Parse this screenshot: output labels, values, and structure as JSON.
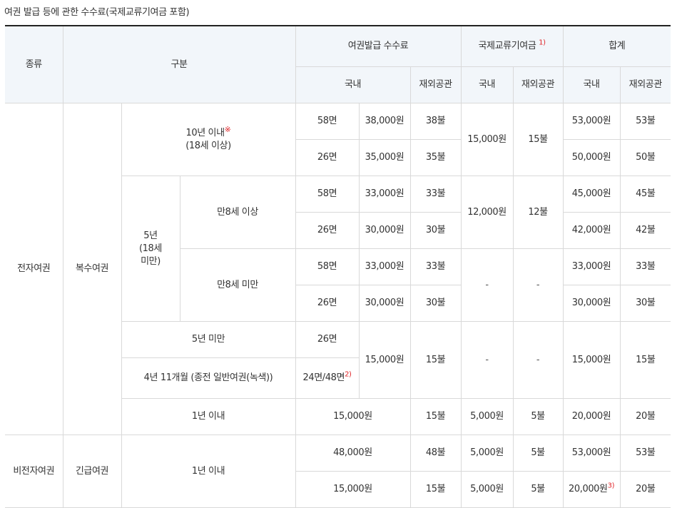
{
  "caption": "여권 발급 등에 관한 수수료(국제교류기여금 포함)",
  "header": {
    "type": "종류",
    "category": "구분",
    "passport_fee": "여권발급 수수료",
    "contribution": "국제교류기여금",
    "contribution_note": "1)",
    "total": "합계",
    "domestic": "국내",
    "overseas": "재외공관"
  },
  "labels": {
    "e_passport": "전자여권",
    "non_e_passport": "비전자여권",
    "multiple": "복수여권",
    "emergency": "긴급여권",
    "ten_years": "10년 이내",
    "ten_mark": "※",
    "ten_age": "(18세 이상)",
    "five_years_a": "5년",
    "five_years_b": "(18세",
    "five_years_c": "미만)",
    "age8_over": "만8세 이상",
    "age8_under": "만8세 미만",
    "under5": "5년 미만",
    "four_years": "4년 11개월 (종전 일반여권(녹색))",
    "one_year": "1년 이내",
    "one_year_b": "1년 이내"
  },
  "rows": [
    {
      "pages": "58면",
      "dom": "38,000원",
      "ovs": "38불",
      "cdom": "15,000원",
      "covs": "15불",
      "tdom": "53,000원",
      "tovs": "53불"
    },
    {
      "pages": "26면",
      "dom": "35,000원",
      "ovs": "35불",
      "tdom": "50,000원",
      "tovs": "50불"
    },
    {
      "pages": "58면",
      "dom": "33,000원",
      "ovs": "33불",
      "cdom": "12,000원",
      "covs": "12불",
      "tdom": "45,000원",
      "tovs": "45불"
    },
    {
      "pages": "26면",
      "dom": "30,000원",
      "ovs": "30불",
      "tdom": "42,000원",
      "tovs": "42불"
    },
    {
      "pages": "58면",
      "dom": "33,000원",
      "ovs": "33불",
      "cdom": "-",
      "covs": "-",
      "tdom": "33,000원",
      "tovs": "33불"
    },
    {
      "pages": "26면",
      "dom": "30,000원",
      "ovs": "30불",
      "tdom": "30,000원",
      "tovs": "30불"
    },
    {
      "pages": "26면",
      "dom": "15,000원",
      "ovs": "15불",
      "cdom": "-",
      "covs": "-",
      "tdom": "15,000원",
      "tovs": "15불"
    },
    {
      "pages": "24면/48면",
      "pages_note": "2)"
    },
    {
      "dom": "15,000원",
      "ovs": "15불",
      "cdom": "5,000원",
      "covs": "5불",
      "tdom": "20,000원",
      "tovs": "20불"
    },
    {
      "dom": "48,000원",
      "ovs": "48불",
      "cdom": "5,000원",
      "covs": "5불",
      "tdom": "53,000원",
      "tovs": "53불"
    },
    {
      "dom": "15,000원",
      "ovs": "15불",
      "cdom": "5,000원",
      "covs": "5불",
      "tdom": "20,000원",
      "tdom_note": "3)",
      "tovs": "20불"
    }
  ]
}
